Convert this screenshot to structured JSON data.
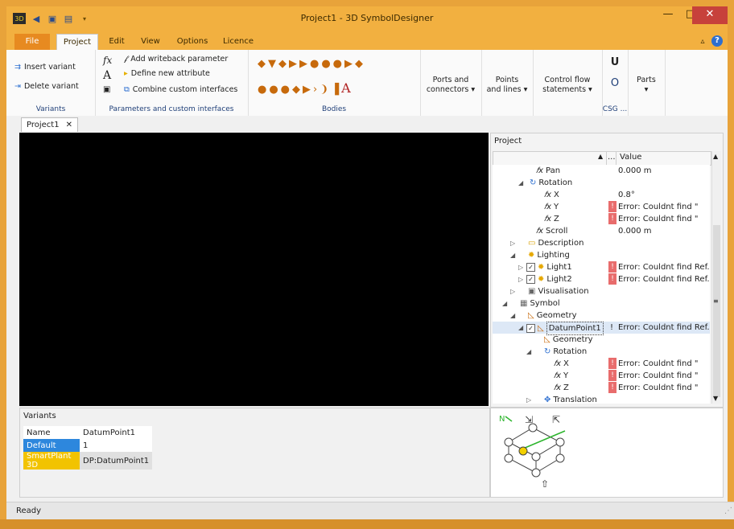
{
  "window": {
    "title": "Project1 - 3D SymbolDesigner"
  },
  "quick_access": [
    "app-icon",
    "back-icon",
    "save-icon",
    "page-icon"
  ],
  "window_controls": {
    "minimize": "—",
    "maximize": "□",
    "close": "✕"
  },
  "menu_tabs": [
    "File",
    "Project",
    "Edit",
    "View",
    "Options",
    "Licence"
  ],
  "ribbon": {
    "variants": {
      "insert": "Insert variant",
      "delete": "Delete variant",
      "label": "Variants"
    },
    "parameters": {
      "add_writeback": "Add writeback parameter",
      "define_attr": "Define new attribute",
      "combine": "Combine custom interfaces",
      "label": "Parameters and custom interfaces"
    },
    "bodies": {
      "label": "Bodies",
      "text_a": "A"
    },
    "ports": {
      "line1": "Ports and",
      "line2": "connectors ▾"
    },
    "points": {
      "line1": "Points",
      "line2": "and lines ▾"
    },
    "control": {
      "line1": "Control flow",
      "line2": "statements ▾"
    },
    "csg": {
      "label": "CSG ...",
      "u": "U",
      "o": "O"
    },
    "parts": {
      "label": "Parts",
      "arrow": "▾"
    }
  },
  "doc_tab": {
    "label": "Project1",
    "close": "✕"
  },
  "project_panel": {
    "title": "Project",
    "col_value": "Value",
    "col_sort": "▲",
    "col_dots": "...",
    "rows": [
      {
        "label": "Pan",
        "value": "0.000 m"
      },
      {
        "label": "Rotation",
        "value": ""
      },
      {
        "label": "X",
        "value": "0.8°"
      },
      {
        "label": "Y",
        "value": "Error: Couldnt find \"",
        "error": true
      },
      {
        "label": "Z",
        "value": "Error: Couldnt find \"",
        "error": true
      },
      {
        "label": "Scroll",
        "value": "0.000 m"
      },
      {
        "label": "Description",
        "value": ""
      },
      {
        "label": "Lighting",
        "value": ""
      },
      {
        "label": "Light1",
        "value": "Error: Couldnt find Ref...",
        "error": true
      },
      {
        "label": "Light2",
        "value": "Error: Couldnt find Ref...",
        "error": true
      },
      {
        "label": "Visualisation",
        "value": ""
      },
      {
        "label": "Symbol",
        "value": ""
      },
      {
        "label": "Geometry",
        "value": ""
      },
      {
        "label": "DatumPoint1",
        "value": "Error: Couldnt find Ref...",
        "error": true
      },
      {
        "label": "Geometry",
        "value": ""
      },
      {
        "label": "Rotation",
        "value": ""
      },
      {
        "label": "X",
        "value": "Error: Couldnt find \"",
        "error": true
      },
      {
        "label": "Y",
        "value": "Error: Couldnt find \"",
        "error": true
      },
      {
        "label": "Z",
        "value": "Error: Couldnt find \"",
        "error": true
      },
      {
        "label": "Translation",
        "value": ""
      }
    ]
  },
  "variants_panel": {
    "title": "Variants",
    "headers": [
      "Name",
      "DatumPoint1"
    ],
    "rows": [
      {
        "name": "Default",
        "value": "1"
      },
      {
        "name": "SmartPlant 3D",
        "value": "DP:DatumPoint1"
      }
    ]
  },
  "navigator": {
    "north_label": "N"
  },
  "status": {
    "text": "Ready"
  },
  "colors": {
    "accent": "#f2b040",
    "file_tab": "#e78a20",
    "error": "#e86c6c",
    "selected_blue": "#2d87dd",
    "selected_yellow": "#f2c300"
  }
}
